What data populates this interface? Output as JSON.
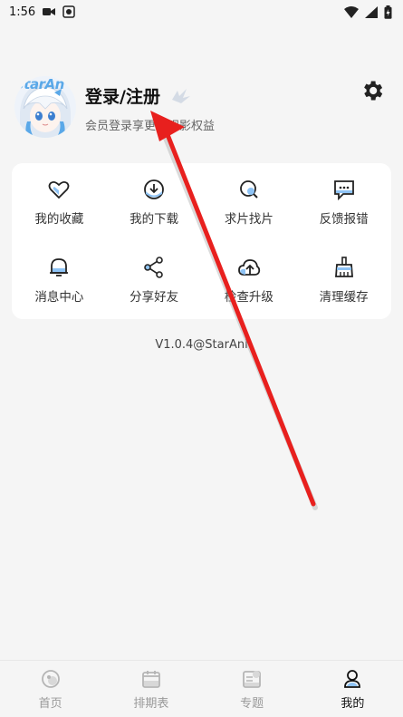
{
  "status": {
    "time": "1:56"
  },
  "profile": {
    "avatar_logo": "StarAn",
    "login_title": "登录/注册",
    "subtitle": "会员登录享更多观影权益"
  },
  "menu": [
    {
      "label": "我的收藏",
      "icon": "heart-icon"
    },
    {
      "label": "我的下载",
      "icon": "download-icon"
    },
    {
      "label": "求片找片",
      "icon": "search-icon"
    },
    {
      "label": "反馈报错",
      "icon": "feedback-icon"
    },
    {
      "label": "消息中心",
      "icon": "bell-icon"
    },
    {
      "label": "分享好友",
      "icon": "share-icon"
    },
    {
      "label": "检查升级",
      "icon": "cloud-upload-icon"
    },
    {
      "label": "清理缓存",
      "icon": "broom-icon"
    }
  ],
  "version": "V1.0.4@StarAni",
  "nav": [
    {
      "label": "首页",
      "icon": "home-icon"
    },
    {
      "label": "排期表",
      "icon": "calendar-icon"
    },
    {
      "label": "专题",
      "icon": "topic-icon"
    },
    {
      "label": "我的",
      "icon": "user-icon"
    }
  ],
  "colors": {
    "accent": "#2f6fd6",
    "icon_fill": "#8ec3f5",
    "arrow": "#e8201e"
  }
}
